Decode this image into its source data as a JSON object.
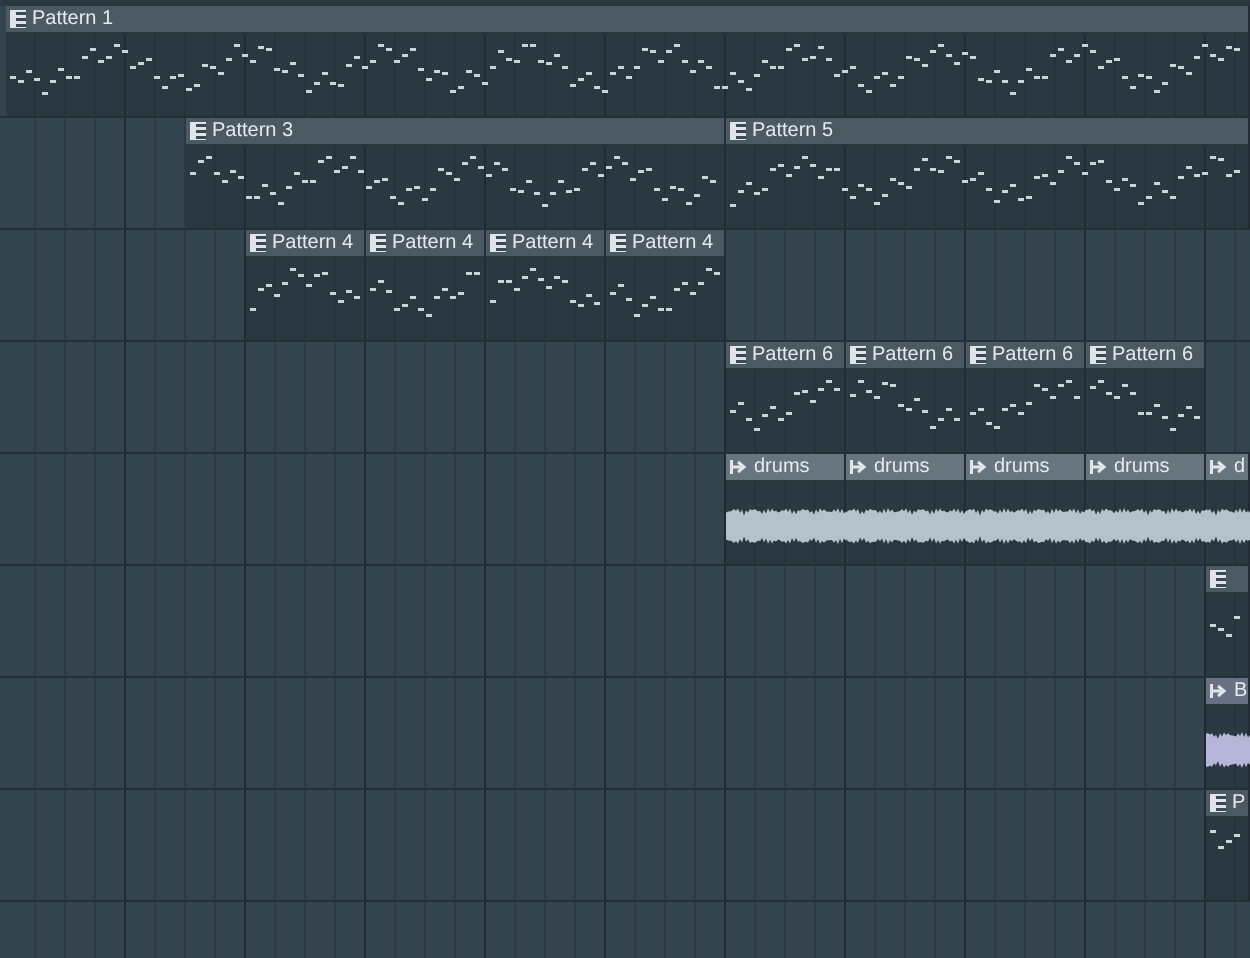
{
  "tracks": [
    {
      "clips": [
        {
          "kind": "pattern",
          "label": "Pattern 1"
        }
      ]
    },
    {
      "clips": [
        {
          "kind": "pattern",
          "label": "Pattern 3"
        },
        {
          "kind": "pattern",
          "label": "Pattern 5"
        }
      ]
    },
    {
      "clips": [
        {
          "kind": "pattern",
          "label": "Pattern 4"
        },
        {
          "kind": "pattern",
          "label": "Pattern 4"
        },
        {
          "kind": "pattern",
          "label": "Pattern 4"
        },
        {
          "kind": "pattern",
          "label": "Pattern 4"
        }
      ]
    },
    {
      "clips": [
        {
          "kind": "pattern",
          "label": "Pattern 6"
        },
        {
          "kind": "pattern",
          "label": "Pattern 6"
        },
        {
          "kind": "pattern",
          "label": "Pattern 6"
        },
        {
          "kind": "pattern",
          "label": "Pattern 6"
        }
      ]
    },
    {
      "clips": [
        {
          "kind": "audio",
          "label": "drums",
          "color": "#b4c2c9"
        },
        {
          "kind": "audio",
          "label": "drums",
          "color": "#b4c2c9"
        },
        {
          "kind": "audio",
          "label": "drums",
          "color": "#b4c2c9"
        },
        {
          "kind": "audio",
          "label": "drums",
          "color": "#b4c2c9"
        },
        {
          "kind": "audio",
          "label": "d",
          "color": "#b4c2c9"
        }
      ]
    },
    {
      "clips": [
        {
          "kind": "pattern"
        }
      ]
    },
    {
      "clips": [
        {
          "kind": "audio",
          "label": "B",
          "color": "#b6b6d8"
        }
      ]
    },
    {
      "clips": [
        {
          "kind": "pattern",
          "label": "P"
        }
      ]
    }
  ]
}
